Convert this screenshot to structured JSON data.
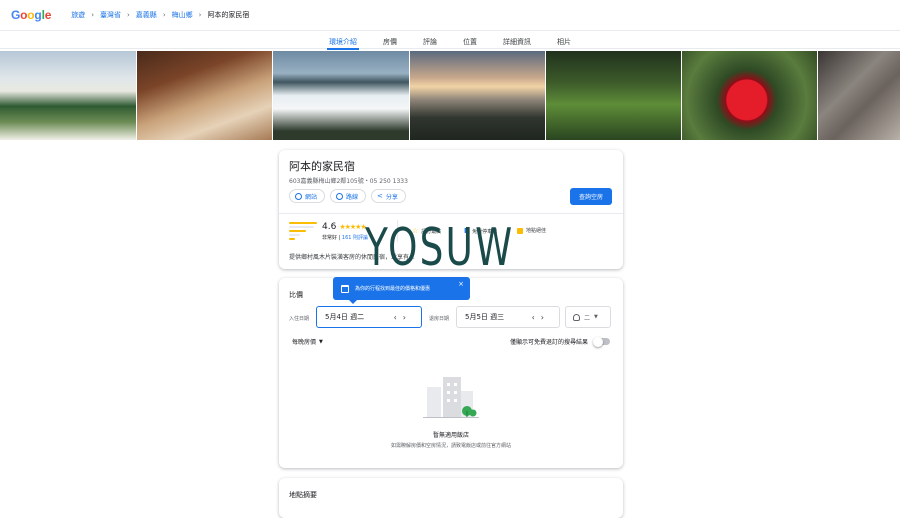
{
  "header": {
    "logo": "Google",
    "breadcrumbs": [
      "旅遊",
      "臺灣省",
      "嘉義縣",
      "梅山鄉",
      "阿本的家民宿"
    ]
  },
  "tabs": [
    "環境介紹",
    "房價",
    "評論",
    "位置",
    "詳細資訊",
    "相片"
  ],
  "hotel": {
    "name": "阿本的家民宿",
    "address": "603嘉義縣梅山鄉2鄰105號・05 250 1333",
    "actions": [
      "網站",
      "路線",
      "分享"
    ],
    "check_button": "查詢空房",
    "rating": "4.6",
    "stars": "★★★★★",
    "rating_label": "非常好",
    "review_count": "161 則評論",
    "amenities": [
      "評分最高",
      "免費停車場",
      "地點絕佳"
    ],
    "description": "提供鄉村風木片裝潢客房的休閒民宿，並享有..."
  },
  "compare": {
    "title": "比價",
    "tooltip": "為你的行程找到最佳的價格和優惠",
    "checkin_label": "入住日期",
    "checkin_value": "5月4日 週二",
    "checkout_label": "退房日期",
    "checkout_value": "5月5日 週三",
    "guests": "二",
    "price_mode": "每晚房價",
    "toggle_label": "僅顯示可免費退訂的搜尋結果",
    "empty_title": "暫無適用飯店",
    "empty_sub": "如需瞭解房價和空房情況，請致電飯店或前往官方網站"
  },
  "summary": {
    "title": "地點摘要"
  },
  "watermark": "YOSUW",
  "colors": {
    "accent": "#1a73e8",
    "star": "#fbbc04"
  }
}
